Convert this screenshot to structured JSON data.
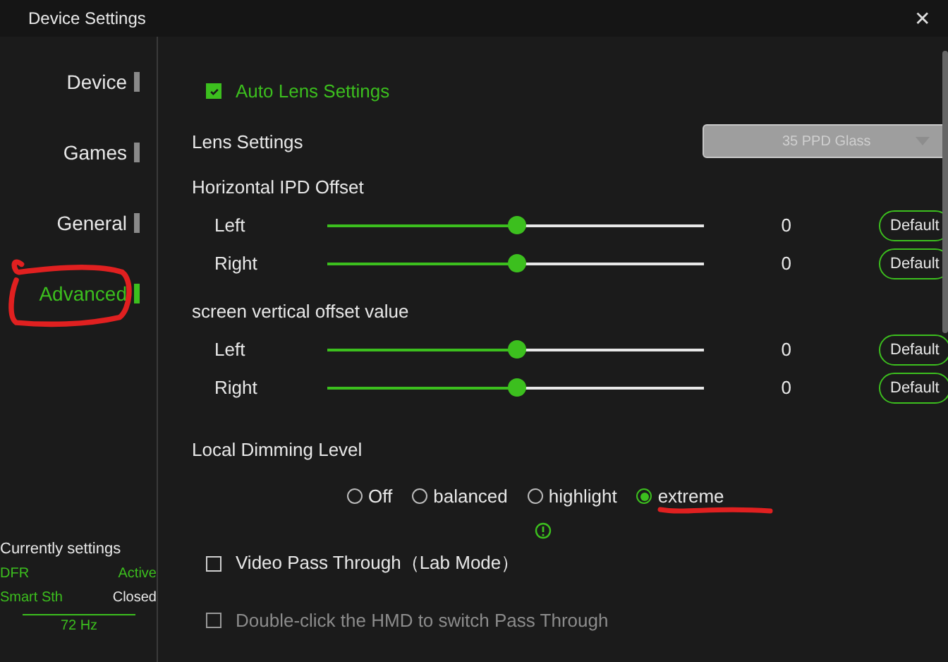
{
  "window": {
    "title": "Device Settings",
    "close": "✕"
  },
  "sidebar": {
    "items": [
      {
        "label": "Device",
        "selected": false
      },
      {
        "label": "Games",
        "selected": false
      },
      {
        "label": "General",
        "selected": false
      },
      {
        "label": "Advanced",
        "selected": true
      }
    ],
    "current": {
      "title": "Currently settings",
      "rows": [
        {
          "name": "DFR",
          "status": "Active",
          "active": true
        },
        {
          "name": "Smart Sth",
          "status": "Closed",
          "active": false
        }
      ],
      "refresh": "72 Hz"
    }
  },
  "auto_lens": {
    "label": "Auto Lens Settings",
    "checked": true
  },
  "lens_settings": {
    "label": "Lens Settings",
    "value": "35 PPD Glass",
    "disabled": true
  },
  "offset_groups": [
    {
      "title": "Horizontal IPD Offset",
      "rows": [
        {
          "label": "Left",
          "level": 0.5,
          "value": "0",
          "button": "Default"
        },
        {
          "label": "Right",
          "level": 0.5,
          "value": "0",
          "button": "Default"
        }
      ]
    },
    {
      "title": "screen vertical offset value",
      "rows": [
        {
          "label": "Left",
          "level": 0.5,
          "value": "0",
          "button": "Default"
        },
        {
          "label": "Right",
          "level": 0.5,
          "value": "0",
          "button": "Default"
        }
      ]
    }
  ],
  "dimming": {
    "title": "Local Dimming Level",
    "options": [
      {
        "label": "Off",
        "selected": false
      },
      {
        "label": "balanced",
        "selected": false
      },
      {
        "label": "highlight",
        "selected": false
      },
      {
        "label": "extreme",
        "selected": true
      }
    ]
  },
  "options": [
    {
      "label": "Video Pass Through（Lab Mode）",
      "checked": false,
      "disabled": false
    },
    {
      "label": "Double-click the HMD to switch Pass Through",
      "checked": false,
      "disabled": true
    }
  ]
}
